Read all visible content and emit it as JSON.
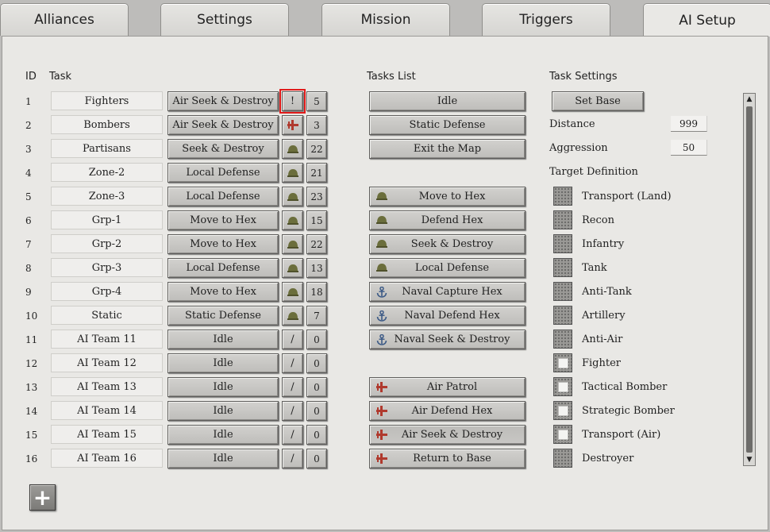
{
  "tabs": [
    "Alliances",
    "Settings",
    "Mission",
    "Triggers",
    "AI Setup"
  ],
  "active_tab": "AI Setup",
  "headers": {
    "id": "ID",
    "task": "Task",
    "tasks_list": "Tasks List",
    "task_settings": "Task Settings"
  },
  "teams": [
    {
      "id": "1",
      "name": "Fighters",
      "task": "Air Seek & Destroy",
      "icon_glyph": "!",
      "icon": "exclamation-icon",
      "count": "5"
    },
    {
      "id": "2",
      "name": "Bombers",
      "task": "Air Seek & Destroy",
      "icon_glyph": "",
      "icon": "aircraft-icon",
      "count": "3"
    },
    {
      "id": "3",
      "name": "Partisans",
      "task": "Seek & Destroy",
      "icon_glyph": "",
      "icon": "helmet-icon",
      "count": "22"
    },
    {
      "id": "4",
      "name": "Zone-2",
      "task": "Local Defense",
      "icon_glyph": "",
      "icon": "helmet-icon",
      "count": "21"
    },
    {
      "id": "5",
      "name": "Zone-3",
      "task": "Local Defense",
      "icon_glyph": "",
      "icon": "helmet-icon",
      "count": "23"
    },
    {
      "id": "6",
      "name": "Grp-1",
      "task": "Move to Hex",
      "icon_glyph": "",
      "icon": "helmet-icon",
      "count": "15"
    },
    {
      "id": "7",
      "name": "Grp-2",
      "task": "Move to Hex",
      "icon_glyph": "",
      "icon": "helmet-icon",
      "count": "22"
    },
    {
      "id": "8",
      "name": "Grp-3",
      "task": "Local Defense",
      "icon_glyph": "",
      "icon": "helmet-icon",
      "count": "13"
    },
    {
      "id": "9",
      "name": "Grp-4",
      "task": "Move to Hex",
      "icon_glyph": "",
      "icon": "helmet-icon",
      "count": "18"
    },
    {
      "id": "10",
      "name": "Static",
      "task": "Static Defense",
      "icon_glyph": "",
      "icon": "helmet-icon",
      "count": "7"
    },
    {
      "id": "11",
      "name": "AI Team 11",
      "task": "Idle",
      "icon_glyph": "/",
      "icon": "slash-icon",
      "count": "0"
    },
    {
      "id": "12",
      "name": "AI Team 12",
      "task": "Idle",
      "icon_glyph": "/",
      "icon": "slash-icon",
      "count": "0"
    },
    {
      "id": "13",
      "name": "AI Team 13",
      "task": "Idle",
      "icon_glyph": "/",
      "icon": "slash-icon",
      "count": "0"
    },
    {
      "id": "14",
      "name": "AI Team 14",
      "task": "Idle",
      "icon_glyph": "/",
      "icon": "slash-icon",
      "count": "0"
    },
    {
      "id": "15",
      "name": "AI Team 15",
      "task": "Idle",
      "icon_glyph": "/",
      "icon": "slash-icon",
      "count": "0"
    },
    {
      "id": "16",
      "name": "AI Team 16",
      "task": "Idle",
      "icon_glyph": "/",
      "icon": "slash-icon",
      "count": "0"
    }
  ],
  "tasks_list": [
    {
      "label": "Idle",
      "icon": "",
      "slot": 0
    },
    {
      "label": "Static Defense",
      "icon": "",
      "slot": 1
    },
    {
      "label": "Exit the Map",
      "icon": "",
      "slot": 2
    },
    {
      "label": "Move to Hex",
      "icon": "helmet-icon",
      "slot": 4
    },
    {
      "label": "Defend Hex",
      "icon": "helmet-icon",
      "slot": 5
    },
    {
      "label": "Seek & Destroy",
      "icon": "helmet-icon",
      "slot": 6
    },
    {
      "label": "Local Defense",
      "icon": "helmet-icon",
      "slot": 7
    },
    {
      "label": "Naval Capture Hex",
      "icon": "anchor-icon",
      "slot": 8
    },
    {
      "label": "Naval Defend Hex",
      "icon": "anchor-icon",
      "slot": 9
    },
    {
      "label": "Naval Seek & Destroy",
      "icon": "anchor-icon",
      "slot": 10
    },
    {
      "label": "Air Patrol",
      "icon": "aircraft-icon",
      "slot": 12
    },
    {
      "label": "Air Defend Hex",
      "icon": "aircraft-icon",
      "slot": 13
    },
    {
      "label": "Air Seek & Destroy",
      "icon": "aircraft-icon",
      "slot": 14,
      "pressed": true
    },
    {
      "label": "Return to Base",
      "icon": "aircraft-icon",
      "slot": 15
    }
  ],
  "task_settings": {
    "set_base_label": "Set Base",
    "distance_label": "Distance",
    "distance_value": "999",
    "aggression_label": "Aggression",
    "aggression_value": "50",
    "target_definition_label": "Target Definition",
    "targets": [
      {
        "label": "Transport (Land)",
        "checked": false
      },
      {
        "label": "Recon",
        "checked": false
      },
      {
        "label": "Infantry",
        "checked": false
      },
      {
        "label": "Tank",
        "checked": false
      },
      {
        "label": "Anti-Tank",
        "checked": false
      },
      {
        "label": "Artillery",
        "checked": false
      },
      {
        "label": "Anti-Air",
        "checked": false
      },
      {
        "label": "Fighter",
        "checked": true
      },
      {
        "label": "Tactical Bomber",
        "checked": true
      },
      {
        "label": "Strategic Bomber",
        "checked": true
      },
      {
        "label": "Transport (Air)",
        "checked": true
      },
      {
        "label": "Destroyer",
        "checked": false
      }
    ]
  },
  "add_button_label": "+",
  "colors": {
    "helmet": "#6b6e3c",
    "aircraft": "#b03a2e",
    "anchor": "#3c5a86",
    "selection": "#e01b1b"
  }
}
